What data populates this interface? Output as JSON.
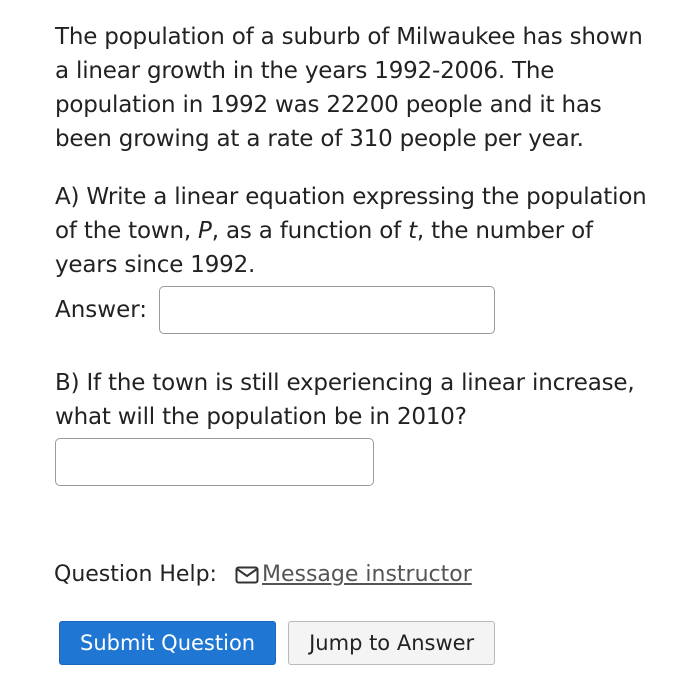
{
  "question": {
    "intro": "The population of a suburb of Milwaukee has shown a linear growth in the years 1992-2006. The population in 1992 was 22200 people and it has been growing at a rate of 310 people per year.",
    "part_a": {
      "prefix": "A)  Write a linear equation expressing the population of the town, ",
      "var_p": "P",
      "middle": ", as a function of ",
      "var_t": "t",
      "suffix": ", the number of years since 1992.",
      "answer_label": "Answer:",
      "answer_value": ""
    },
    "part_b": {
      "text": "B)  If the town is still experiencing a linear increase, what will the population be in 2010?",
      "answer_value": ""
    }
  },
  "help": {
    "label": "Question Help:",
    "icon": "mail-icon",
    "link_label": "Message instructor"
  },
  "buttons": {
    "submit_label": "Submit Question",
    "jump_label": "Jump to Answer"
  },
  "colors": {
    "submit_bg": "#1f76d3",
    "link": "#555555"
  }
}
